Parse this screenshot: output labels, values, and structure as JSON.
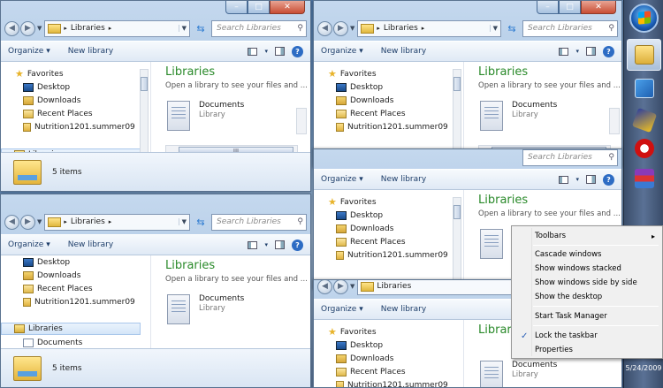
{
  "window": {
    "breadcrumb": "Libraries",
    "search_placeholder": "Search Libraries",
    "toolbar": {
      "organize": "Organize",
      "new_library": "New library"
    },
    "nav": {
      "favorites": "Favorites",
      "items": [
        "Desktop",
        "Downloads",
        "Recent Places",
        "Nutrition1201.summer09"
      ],
      "libraries": "Libraries",
      "documents": "Documents"
    },
    "main": {
      "title": "Libraries",
      "subtitle": "Open a library to see your files and ...",
      "doc_name": "Documents",
      "doc_type": "Library"
    },
    "status_count": "5 items",
    "scroll_grip": "III",
    "caption": {
      "minimize": "–",
      "maximize": "□",
      "close": "✕"
    }
  },
  "context_menu": {
    "items": [
      "Toolbars",
      "Cascade windows",
      "Show windows stacked",
      "Show windows side by side",
      "Show the desktop",
      "Start Task Manager",
      "Lock the taskbar",
      "Properties"
    ],
    "checked": "Lock the taskbar",
    "check_glyph": "✓",
    "submenu_glyph": "▸"
  },
  "taskbar": {
    "clock_date": "5/24/2009"
  },
  "colors": {
    "library_title": "#2a8a2a",
    "accent": "#2d62b8"
  }
}
